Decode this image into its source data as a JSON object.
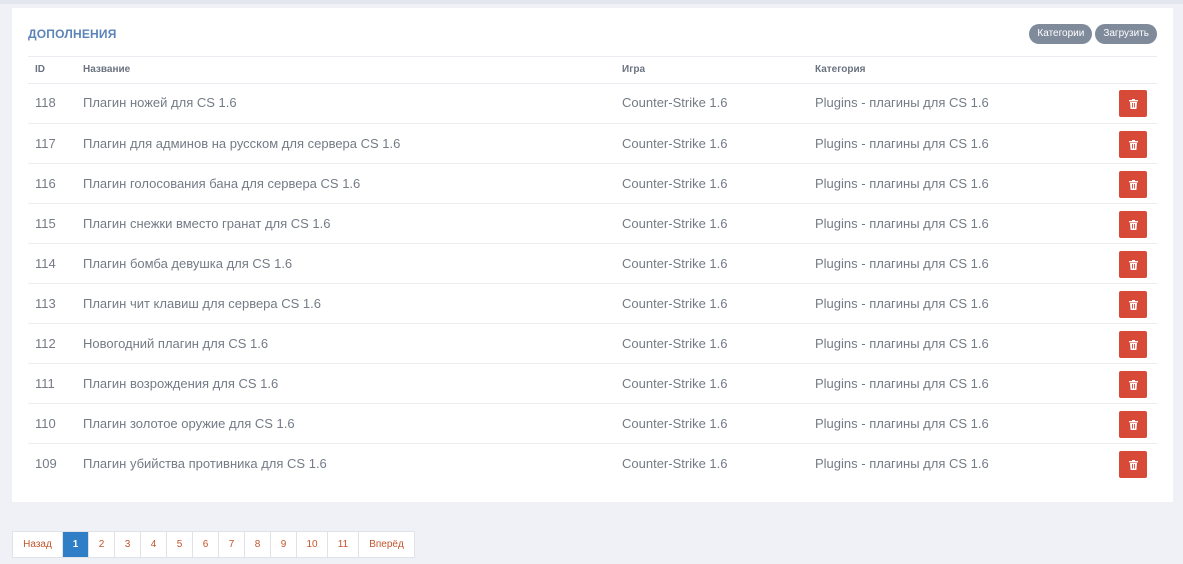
{
  "panel": {
    "title": "ДОПОЛНЕНИЯ",
    "buttons": {
      "categories": "Категории",
      "upload": "Загрузить"
    }
  },
  "table": {
    "headers": {
      "id": "ID",
      "name": "Название",
      "game": "Игра",
      "category": "Категория"
    },
    "rows": [
      {
        "id": "118",
        "name": "Плагин ножей для CS 1.6",
        "game": "Counter-Strike 1.6",
        "category": "Plugins - плагины для CS 1.6"
      },
      {
        "id": "117",
        "name": "Плагин для админов на русском для сервера CS 1.6",
        "game": "Counter-Strike 1.6",
        "category": "Plugins - плагины для CS 1.6"
      },
      {
        "id": "116",
        "name": "Плагин голосования бана для сервера CS 1.6",
        "game": "Counter-Strike 1.6",
        "category": "Plugins - плагины для CS 1.6"
      },
      {
        "id": "115",
        "name": "Плагин снежки вместо гранат для CS 1.6",
        "game": "Counter-Strike 1.6",
        "category": "Plugins - плагины для CS 1.6"
      },
      {
        "id": "114",
        "name": "Плагин бомба девушка для CS 1.6",
        "game": "Counter-Strike 1.6",
        "category": "Plugins - плагины для CS 1.6"
      },
      {
        "id": "113",
        "name": "Плагин чит клавиш для сервера CS 1.6",
        "game": "Counter-Strike 1.6",
        "category": "Plugins - плагины для CS 1.6"
      },
      {
        "id": "112",
        "name": "Новогодний плагин для CS 1.6",
        "game": "Counter-Strike 1.6",
        "category": "Plugins - плагины для CS 1.6"
      },
      {
        "id": "111",
        "name": "Плагин возрождения для CS 1.6",
        "game": "Counter-Strike 1.6",
        "category": "Plugins - плагины для CS 1.6"
      },
      {
        "id": "110",
        "name": "Плагин золотое оружие для CS 1.6",
        "game": "Counter-Strike 1.6",
        "category": "Plugins - плагины для CS 1.6"
      },
      {
        "id": "109",
        "name": "Плагин убийства противника для CS 1.6",
        "game": "Counter-Strike 1.6",
        "category": "Plugins - плагины для CS 1.6"
      }
    ],
    "delete_icon": "trash-icon"
  },
  "pagination": {
    "prev": "Назад",
    "next": "Вперёд",
    "pages": [
      "1",
      "2",
      "3",
      "4",
      "5",
      "6",
      "7",
      "8",
      "9",
      "10",
      "11"
    ],
    "current": "1"
  },
  "colors": {
    "accent": "#2f7ec6",
    "title": "#5b84b8",
    "delete": "#d84a38",
    "pill": "#7f8a9b",
    "page_link": "#c0552b"
  }
}
